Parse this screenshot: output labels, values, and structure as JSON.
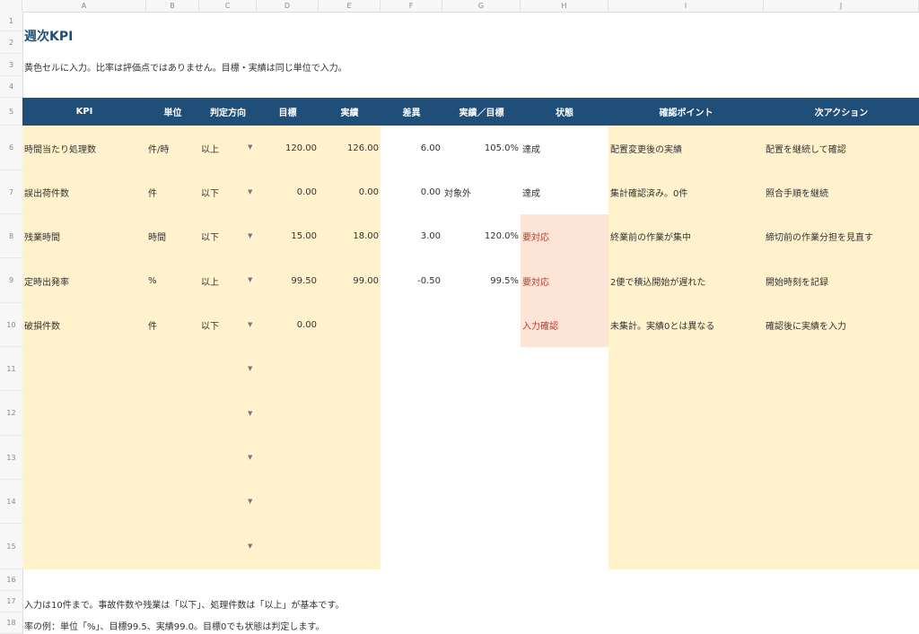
{
  "columns": [
    "A",
    "B",
    "C",
    "D",
    "E",
    "F",
    "G",
    "H",
    "I",
    "J"
  ],
  "rows": [
    "1",
    "2",
    "3",
    "4",
    "5",
    "6",
    "7",
    "8",
    "9",
    "10",
    "11",
    "12",
    "13",
    "14",
    "15",
    "16",
    "17",
    "18"
  ],
  "title": "週次KPI",
  "instruction": "黄色セルに入力。比率は評価点ではありません。目標・実績は同じ単位で入力。",
  "headers": [
    "KPI",
    "単位",
    "判定方向",
    "目標",
    "実績",
    "差異",
    "実績／目標",
    "状態",
    "確認ポイント",
    "次アクション"
  ],
  "dropdown_glyph": "▼",
  "data_rows": [
    {
      "kpi": "時間当たり処理数",
      "unit": "件/時",
      "dir": "以上",
      "target": "120.00",
      "actual": "126.00",
      "diff": "6.00",
      "ratio": "105.0%",
      "status": "達成",
      "check": "配置変更後の実績",
      "action": "配置を継続して確認"
    },
    {
      "kpi": "誤出荷件数",
      "unit": "件",
      "dir": "以下",
      "target": "0.00",
      "actual": "0.00",
      "diff": "0.00",
      "ratio": "対象外",
      "status": "達成",
      "check": "集計確認済み。0件",
      "action": "照合手順を継続"
    },
    {
      "kpi": "残業時間",
      "unit": "時間",
      "dir": "以下",
      "target": "15.00",
      "actual": "18.00",
      "diff": "3.00",
      "ratio": "120.0%",
      "status": "要対応",
      "check": "終業前の作業が集中",
      "action": "締切前の作業分担を見直す"
    },
    {
      "kpi": "定時出発率",
      "unit": "%",
      "dir": "以上",
      "target": "99.50",
      "actual": "99.00",
      "diff": "-0.50",
      "ratio": "99.5%",
      "status": "要対応",
      "check": "2便で積込開始が遅れた",
      "action": "開始時刻を記録"
    },
    {
      "kpi": "破損件数",
      "unit": "件",
      "dir": "以下",
      "target": "0.00",
      "actual": "",
      "diff": "",
      "ratio": "",
      "status": "入力確認",
      "check": "未集計。実績0とは異なる",
      "action": "確認後に実績を入力"
    }
  ],
  "footnote1": "入力は10件まで。事故件数や残業は「以下」、処理件数は「以上」が基本です。",
  "footnote2": "率の例：単位「%」、目標99.5、実績99.0。目標0でも状態は判定します。"
}
